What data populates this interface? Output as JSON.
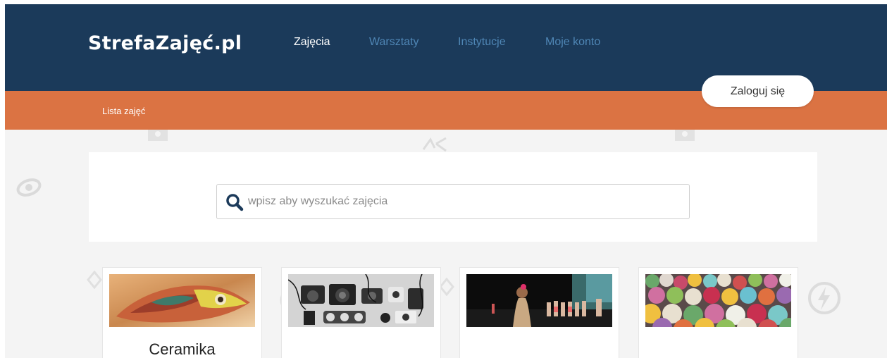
{
  "header": {
    "logo": "StrefaZajęć.pl",
    "nav": [
      {
        "label": "Zajęcia",
        "active": true
      },
      {
        "label": "Warsztaty",
        "active": false
      },
      {
        "label": "Instytucje",
        "active": false
      },
      {
        "label": "Moje konto",
        "active": false
      }
    ],
    "login_label": "Zaloguj się"
  },
  "subbar": {
    "breadcrumb": "Lista zajęć"
  },
  "search": {
    "placeholder": "wpisz aby wyszukać zajęcia"
  },
  "cards": [
    {
      "title": "Ceramika",
      "image": "ceramic-fish-photo"
    },
    {
      "title": "",
      "image": "cameras-flatlay-photo"
    },
    {
      "title": "",
      "image": "kids-stage-dance-photo"
    },
    {
      "title": "",
      "image": "felt-balls-rug-photo"
    }
  ],
  "colors": {
    "header_bg": "#1b3a5a",
    "accent_orange": "#db7343",
    "nav_inactive": "#4f86b5"
  }
}
